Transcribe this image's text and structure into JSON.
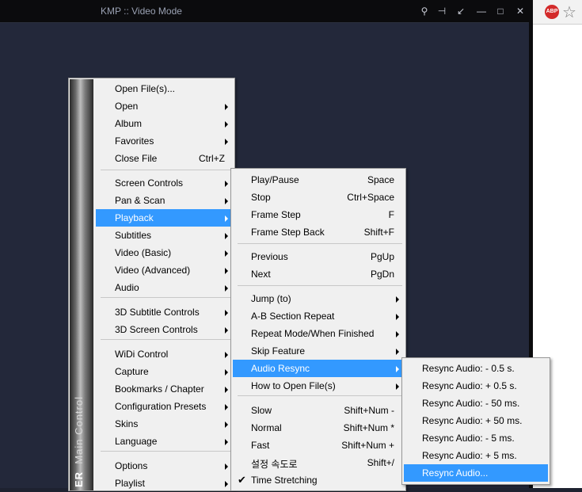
{
  "window": {
    "title": "KMP :: Video Mode",
    "title_buttons": [
      "search-icon",
      "pin-icon",
      "minimize-to-tray-icon",
      "minimize-icon",
      "maximize-icon",
      "close-icon"
    ]
  },
  "browser": {
    "abp_label": "ABP"
  },
  "main_menu": {
    "side_title": "Main Control",
    "side_title_prefix": "ER",
    "items": [
      {
        "label": "Open File(s)...",
        "shortcut": ""
      },
      {
        "label": "Open",
        "shortcut": "",
        "submenu": true
      },
      {
        "label": "Album",
        "shortcut": "",
        "submenu": true
      },
      {
        "label": "Favorites",
        "shortcut": "",
        "submenu": true
      },
      {
        "label": "Close File",
        "shortcut": "Ctrl+Z"
      },
      {
        "label": "Screen Controls",
        "shortcut": "",
        "submenu": true
      },
      {
        "label": "Pan & Scan",
        "shortcut": "",
        "submenu": true
      },
      {
        "label": "Playback",
        "shortcut": "",
        "submenu": true,
        "highlighted": true
      },
      {
        "label": "Subtitles",
        "shortcut": "",
        "submenu": true
      },
      {
        "label": "Video (Basic)",
        "shortcut": "",
        "submenu": true
      },
      {
        "label": "Video (Advanced)",
        "shortcut": "",
        "submenu": true
      },
      {
        "label": "Audio",
        "shortcut": "",
        "submenu": true
      },
      {
        "label": "3D Subtitle Controls",
        "shortcut": "",
        "submenu": true
      },
      {
        "label": "3D Screen Controls",
        "shortcut": "",
        "submenu": true
      },
      {
        "label": "WiDi Control",
        "shortcut": "",
        "submenu": true
      },
      {
        "label": "Capture",
        "shortcut": "",
        "submenu": true
      },
      {
        "label": "Bookmarks / Chapter",
        "shortcut": "",
        "submenu": true
      },
      {
        "label": "Configuration Presets",
        "shortcut": "",
        "submenu": true
      },
      {
        "label": "Skins",
        "shortcut": "",
        "submenu": true
      },
      {
        "label": "Language",
        "shortcut": "",
        "submenu": true
      },
      {
        "label": "Options",
        "shortcut": "",
        "submenu": true
      },
      {
        "label": "Playlist",
        "shortcut": "",
        "submenu": true
      }
    ]
  },
  "playback_menu": {
    "items": [
      {
        "label": "Play/Pause",
        "shortcut": "Space"
      },
      {
        "label": "Stop",
        "shortcut": "Ctrl+Space"
      },
      {
        "label": "Frame Step",
        "shortcut": "F"
      },
      {
        "label": "Frame Step Back",
        "shortcut": "Shift+F"
      },
      {
        "label": "Previous",
        "shortcut": "PgUp"
      },
      {
        "label": "Next",
        "shortcut": "PgDn"
      },
      {
        "label": "Jump (to)",
        "shortcut": "",
        "submenu": true
      },
      {
        "label": "A-B Section Repeat",
        "shortcut": "",
        "submenu": true
      },
      {
        "label": "Repeat Mode/When Finished",
        "shortcut": "",
        "submenu": true
      },
      {
        "label": "Skip Feature",
        "shortcut": "",
        "submenu": true
      },
      {
        "label": "Audio Resync",
        "shortcut": "",
        "submenu": true,
        "highlighted": true
      },
      {
        "label": "How to Open File(s)",
        "shortcut": "",
        "submenu": true
      },
      {
        "label": "Slow",
        "shortcut": "Shift+Num -"
      },
      {
        "label": "Normal",
        "shortcut": "Shift+Num *"
      },
      {
        "label": "Fast",
        "shortcut": "Shift+Num +"
      },
      {
        "label": "설정 속도로",
        "shortcut": "Shift+/"
      },
      {
        "label": "Time Stretching",
        "shortcut": "",
        "checked": true
      }
    ]
  },
  "resync_menu": {
    "items": [
      {
        "label": "Resync Audio: - 0.5 s."
      },
      {
        "label": "Resync Audio: + 0.5 s."
      },
      {
        "label": "Resync Audio: - 50 ms."
      },
      {
        "label": "Resync Audio: + 50 ms."
      },
      {
        "label": "Resync Audio: - 5 ms."
      },
      {
        "label": "Resync Audio: + 5 ms."
      },
      {
        "label": "Resync Audio...",
        "highlighted": true
      }
    ]
  },
  "colors": {
    "highlight": "#3399ff",
    "menu_bg": "#f0f0f0",
    "video_bg": "#23283a"
  }
}
